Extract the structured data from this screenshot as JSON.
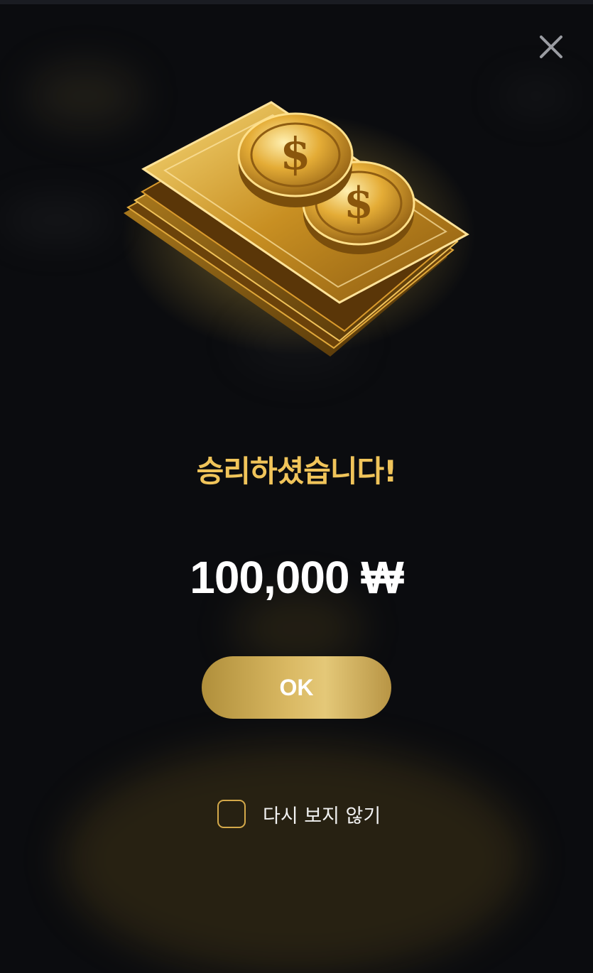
{
  "dialog": {
    "title": "승리하셨습니다!",
    "amount": "100,000 ₩",
    "ok_label": "OK",
    "dont_show_again_label": "다시 보지 않기",
    "dont_show_again_checked": false
  },
  "icons": {
    "close": "close-icon",
    "hero": "gold-money-stack-icon",
    "coin_symbol": "$"
  },
  "colors": {
    "background": "#0b0c0f",
    "title": "#f0c45a",
    "amount": "#ffffff",
    "button_gold": "#d9b862",
    "checkbox_border": "#d4a94a"
  }
}
